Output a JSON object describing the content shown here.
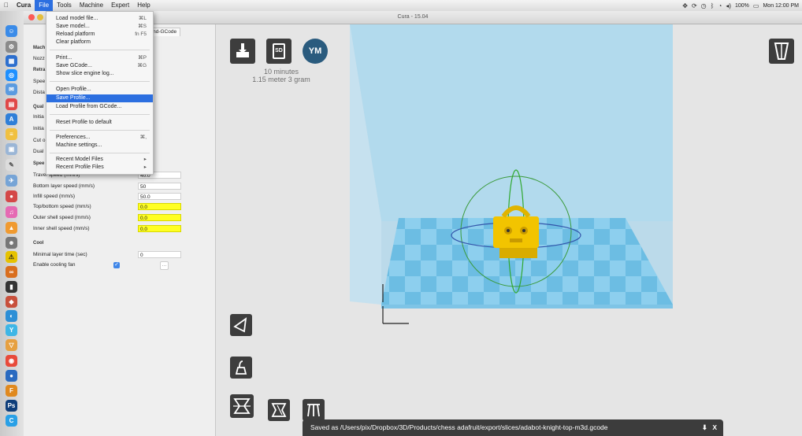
{
  "menubar": {
    "app": "Cura",
    "items": [
      "File",
      "Tools",
      "Machine",
      "Expert",
      "Help"
    ],
    "active": "File",
    "battery": "100%",
    "clock": "Mon 12:00 PM"
  },
  "window": {
    "title": "Cura - 15.04"
  },
  "panel": {
    "tab_label": "rt/End-GCode",
    "hidden_left_labels": [
      "Mach",
      "Nozz",
      "Retra",
      "Spee",
      "Dista",
      "Qual",
      "Initia",
      "Initia",
      "Cut o",
      "Dual",
      "Spee"
    ],
    "speed_rows": [
      {
        "label": "Travel speed (mm/s)",
        "value": "40.0",
        "highlight": false
      },
      {
        "label": "Bottom layer speed (mm/s)",
        "value": "50",
        "highlight": false
      },
      {
        "label": "Infill speed (mm/s)",
        "value": "50.0",
        "highlight": false
      },
      {
        "label": "Top/bottom speed (mm/s)",
        "value": "0.0",
        "highlight": true
      },
      {
        "label": "Outer shell speed (mm/s)",
        "value": "0.0",
        "highlight": true
      },
      {
        "label": "Inner shell speed (mm/s)",
        "value": "0.0",
        "highlight": true
      }
    ],
    "cool_section": "Cool",
    "min_layer_time_label": "Minimal layer time (sec)",
    "min_layer_time_value": "0",
    "cooling_fan_label": "Enable cooling fan",
    "cooling_fan_checked": true
  },
  "file_menu": {
    "items": [
      {
        "label": "Load model file...",
        "shortcut": "⌘L"
      },
      {
        "label": "Save model...",
        "shortcut": "⌘S"
      },
      {
        "label": "Reload platform",
        "shortcut": "fn F5"
      },
      {
        "label": "Clear platform",
        "shortcut": ""
      },
      {
        "label": "Print...",
        "shortcut": "⌘P"
      },
      {
        "label": "Save GCode...",
        "shortcut": "⌘G"
      },
      {
        "label": "Show slice engine log...",
        "shortcut": ""
      },
      {
        "label": "Open Profile...",
        "shortcut": ""
      },
      {
        "label": "Save Profile...",
        "shortcut": ""
      },
      {
        "label": "Load Profile from GCode...",
        "shortcut": ""
      },
      {
        "label": "Reset Profile to default",
        "shortcut": ""
      },
      {
        "label": "Preferences...",
        "shortcut": "⌘,"
      },
      {
        "label": "Machine settings...",
        "shortcut": ""
      },
      {
        "label": "Recent Model Files",
        "shortcut": "▸"
      },
      {
        "label": "Recent Profile Files",
        "shortcut": "▸"
      }
    ],
    "highlighted": "Save Profile..."
  },
  "viewport": {
    "print_time": "10 minutes",
    "material": "1.15 meter 3 gram",
    "sd_label": "SD",
    "ym_label": "YM",
    "status_message": "Saved as /Users/pix/Dropbox/3D/Products/chess adafruit/export/slices/adabot-knight-top-m3d.gcode",
    "status_close": "X"
  },
  "colors": {
    "accent_blue": "#2c6fe0",
    "highlight_yellow": "#ffff22",
    "toolbar_dark": "#3d3d3d",
    "build_volume": "#9fd2ec",
    "model_yellow": "#f2c400"
  }
}
